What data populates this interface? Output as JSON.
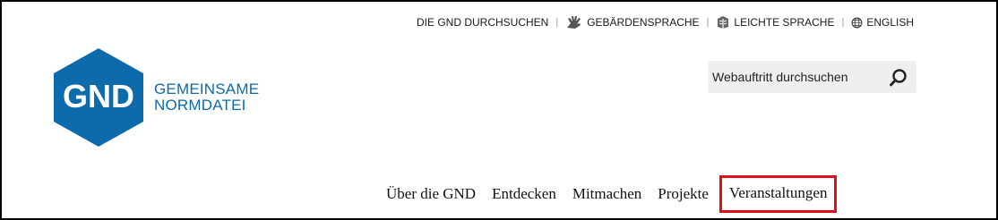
{
  "meta_nav": {
    "search_gnd": "DIE GND DURCHSUCHEN",
    "sign_language": "GEBÄRDENSPRACHE",
    "easy_language": "LEICHTE SPRACHE",
    "english": "ENGLISH",
    "separator": "|"
  },
  "logo": {
    "abbr": "GND",
    "line1": "GEMEINSAME",
    "line2": "NORMDATEI",
    "brand_color": "#0d6aab"
  },
  "search": {
    "placeholder": "Webauftritt durchsuchen",
    "value": ""
  },
  "main_nav": {
    "items": [
      {
        "label": "Über die GND"
      },
      {
        "label": "Entdecken"
      },
      {
        "label": "Mitmachen"
      },
      {
        "label": "Projekte"
      },
      {
        "label": "Veranstaltungen"
      }
    ],
    "highlight_color": "#e0101a"
  }
}
